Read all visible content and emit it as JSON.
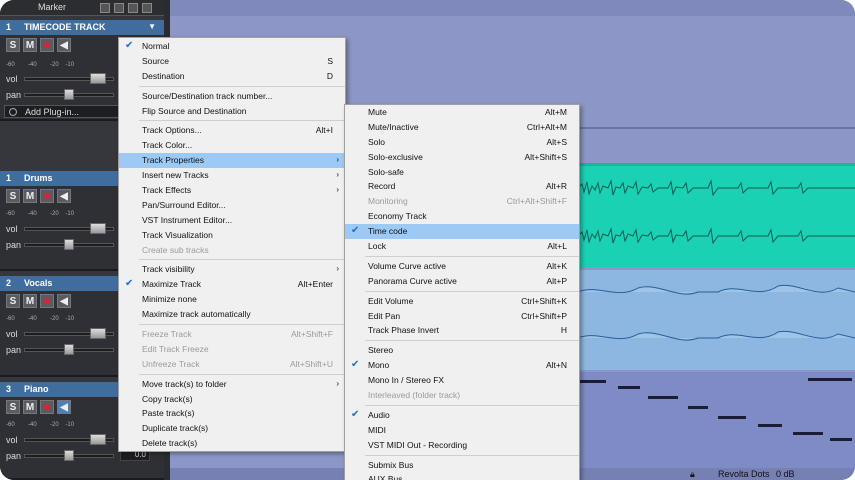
{
  "marker": {
    "label": "Marker"
  },
  "tracks": [
    {
      "number": "1",
      "name": "TIMECODE TRACK",
      "plugin": "Add Plug-in..."
    },
    {
      "number": "1",
      "name": "Drums"
    },
    {
      "number": "2",
      "name": "Vocals"
    },
    {
      "number": "3",
      "name": "Piano",
      "value": "0.0"
    }
  ],
  "track_buttons": {
    "solo": "S",
    "mute": "M"
  },
  "sliders": {
    "vol": "vol",
    "pan": "pan"
  },
  "scale": [
    "-60",
    "-40",
    "-20",
    "-10"
  ],
  "status": {
    "name": "Revolta Dots",
    "db": "0 dB"
  },
  "menu_main": {
    "groups": [
      [
        {
          "label": "Normal",
          "checked": true
        },
        {
          "label": "Source",
          "shortcut": "S"
        },
        {
          "label": "Destination",
          "shortcut": "D"
        }
      ],
      [
        {
          "label": "Source/Destination track number..."
        },
        {
          "label": "Flip Source and Destination"
        }
      ],
      [
        {
          "label": "Track Options...",
          "shortcut": "Alt+I"
        },
        {
          "label": "Track Color..."
        },
        {
          "label": "Track Properties",
          "submenu": true,
          "highlighted": true
        },
        {
          "label": "Insert new Tracks",
          "submenu": true
        },
        {
          "label": "Track Effects",
          "submenu": true
        },
        {
          "label": "Pan/Surround Editor..."
        },
        {
          "label": "VST Instrument Editor..."
        },
        {
          "label": "Track Visualization"
        },
        {
          "label": "Create sub tracks",
          "disabled": true
        }
      ],
      [
        {
          "label": "Track visibility",
          "submenu": true
        },
        {
          "label": "Maximize Track",
          "shortcut": "Alt+Enter",
          "checked": true
        },
        {
          "label": "Minimize none"
        },
        {
          "label": "Maximize track automatically"
        }
      ],
      [
        {
          "label": "Freeze Track",
          "shortcut": "Alt+Shift+F",
          "disabled": true
        },
        {
          "label": "Edit Track Freeze",
          "disabled": true
        },
        {
          "label": "Unfreeze Track",
          "shortcut": "Alt+Shift+U",
          "disabled": true
        }
      ],
      [
        {
          "label": "Move track(s) to folder",
          "submenu": true
        },
        {
          "label": "Copy track(s)"
        },
        {
          "label": "Paste track(s)"
        },
        {
          "label": "Duplicate track(s)"
        },
        {
          "label": "Delete track(s)"
        }
      ]
    ]
  },
  "menu_props": {
    "groups": [
      [
        {
          "label": "Mute",
          "shortcut": "Alt+M"
        },
        {
          "label": "Mute/Inactive",
          "shortcut": "Ctrl+Alt+M"
        },
        {
          "label": "Solo",
          "shortcut": "Alt+S"
        },
        {
          "label": "Solo-exclusive",
          "shortcut": "Alt+Shift+S"
        },
        {
          "label": "Solo-safe"
        },
        {
          "label": "Record",
          "shortcut": "Alt+R"
        },
        {
          "label": "Monitoring",
          "shortcut": "Ctrl+Alt+Shift+F",
          "disabled": true
        },
        {
          "label": "Economy Track"
        },
        {
          "label": "Time code",
          "checked": true,
          "highlighted": true
        },
        {
          "label": "Lock",
          "shortcut": "Alt+L"
        }
      ],
      [
        {
          "label": "Volume Curve active",
          "shortcut": "Alt+K"
        },
        {
          "label": "Panorama Curve active",
          "shortcut": "Alt+P"
        }
      ],
      [
        {
          "label": "Edit Volume",
          "shortcut": "Ctrl+Shift+K"
        },
        {
          "label": "Edit Pan",
          "shortcut": "Ctrl+Shift+P"
        },
        {
          "label": "Track Phase Invert",
          "shortcut": "H"
        }
      ],
      [
        {
          "label": "Stereo"
        },
        {
          "label": "Mono",
          "shortcut": "Alt+N",
          "checked": true
        },
        {
          "label": "Mono In / Stereo FX"
        },
        {
          "label": "Interleaved (folder track)",
          "disabled": true
        }
      ],
      [
        {
          "label": "Audio",
          "checked": true
        },
        {
          "label": "MIDI"
        },
        {
          "label": "VST MIDI Out - Recording"
        }
      ],
      [
        {
          "label": "Submix Bus"
        },
        {
          "label": "AUX Bus"
        }
      ]
    ]
  },
  "colors": {
    "accent": "#9ccaf4",
    "track_header": "#3f6d9e",
    "clip_green": "#1ad1b3",
    "clip_blue": "#8db7e0"
  }
}
